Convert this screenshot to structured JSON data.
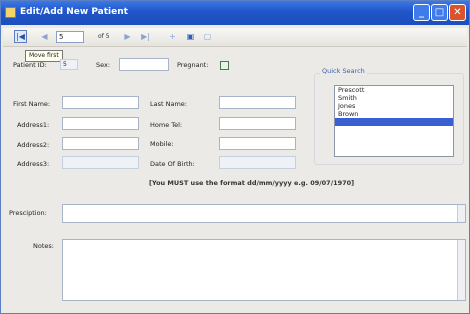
{
  "window": {
    "title": "Edit/Add New Patient",
    "minimize_label": "_",
    "maximize_label": "□",
    "close_label": "✕"
  },
  "toolbar": {
    "position": "5",
    "of_label": "of 5",
    "tooltip": "Move first"
  },
  "form": {
    "patient_id_label": "Patient ID:",
    "patient_id_value": "5",
    "sex_label": "Sex:",
    "pregnant_label": "Pregnant:",
    "first_name_label": "First Name:",
    "last_name_label": "Last Name:",
    "address1_label": "Address1:",
    "home_tel_label": "Home Tel:",
    "address2_label": "Address2:",
    "mobile_label": "Mobile:",
    "address3_label": "Address3:",
    "dob_label": "Date Of Birth:",
    "date_note": "[You MUST use the format dd/mm/yyyy e.g. 09/07/1970]",
    "prescription_label": "Presciption:",
    "notes_label": "Notes:"
  },
  "quick_search": {
    "title": "Quick Search",
    "items": [
      "Prescott",
      "Smith",
      "Jones",
      "Brown",
      ""
    ],
    "selected_index": 4
  }
}
